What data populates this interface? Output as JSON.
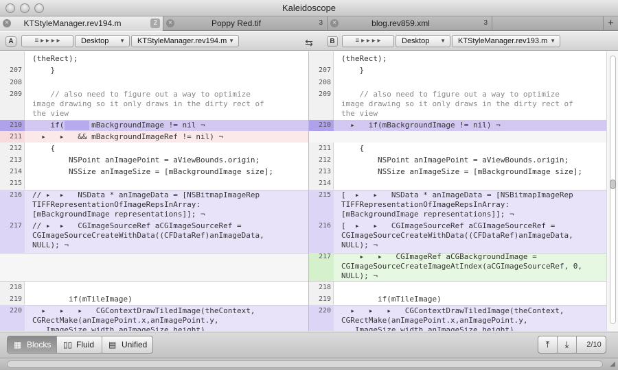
{
  "app": {
    "title": "Kaleidoscope"
  },
  "tabs": [
    {
      "label": "KTStyleManager.rev194.m",
      "count": "2"
    },
    {
      "label": "Poppy Red.tif",
      "count": "3"
    },
    {
      "label": "blog.rev859.xml",
      "count": "3"
    }
  ],
  "tab_add_label": "+",
  "pathbar": {
    "left": {
      "side": "A",
      "folder": "Desktop",
      "file": "KTStyleManager.rev194.m"
    },
    "right": {
      "side": "B",
      "folder": "Desktop",
      "file": "KTStyleManager.rev193.m"
    },
    "swap_icon": "⇆"
  },
  "left_pane": {
    "lines": [
      {
        "n": "",
        "text": "(theRect);"
      },
      {
        "n": "207",
        "text": "    }"
      },
      {
        "n": "208",
        "text": ""
      },
      {
        "n": "209",
        "text": "    // also need to figure out a way to optimize\nimage drawing so it only draws in the dirty rect of\nthe view"
      },
      {
        "n": "210",
        "text": "    if(      mBackgroundImage != nil ¬"
      },
      {
        "n": "211",
        "text": "  ▸   ▸   && mBackgroundImageRef != nil) ¬"
      },
      {
        "n": "212",
        "text": "    {"
      },
      {
        "n": "213",
        "text": "        NSPoint anImagePoint = aViewBounds.origin;"
      },
      {
        "n": "214",
        "text": "        NSSize anImageSize = [mBackgroundImage size];"
      },
      {
        "n": "215",
        "text": ""
      },
      {
        "n": "216",
        "text": "// ▸  ▸   NSData * anImageData = [NSBitmapImageRep\nTIFFRepresentationOfImageRepsInArray:\n[mBackgroundImage representations]]; ¬"
      },
      {
        "n": "217",
        "text": "// ▸  ▸   CGImageSourceRef aCGImageSourceRef =\nCGImageSourceCreateWithData((CFDataRef)anImageData,\nNULL); ¬"
      },
      {
        "n": "218",
        "text": ""
      },
      {
        "n": "219",
        "text": "        if(mTileImage)"
      },
      {
        "n": "220",
        "text": "  ▸   ▸   ▸   CGContextDrawTiledImage(theContext,\nCGRectMake(anImagePoint.x,anImagePoint.y,\n   ImageSize.width,anImageSize.height),"
      }
    ]
  },
  "right_pane": {
    "lines": [
      {
        "n": "",
        "text": "(theRect);"
      },
      {
        "n": "207",
        "text": "    }"
      },
      {
        "n": "208",
        "text": ""
      },
      {
        "n": "209",
        "text": "    // also need to figure out a way to optimize\nimage drawing so it only draws in the dirty rect of\nthe view"
      },
      {
        "n": "210",
        "text": "  ▸   if(mBackgroundImage != nil) ¬"
      },
      {
        "n": "211",
        "text": "    {"
      },
      {
        "n": "212",
        "text": "        NSPoint anImagePoint = aViewBounds.origin;"
      },
      {
        "n": "213",
        "text": "        NSSize anImageSize = [mBackgroundImage size];"
      },
      {
        "n": "214",
        "text": ""
      },
      {
        "n": "215",
        "text": "[  ▸   ▸   NSData * anImageData = [NSBitmapImageRep\nTIFFRepresentationOfImageRepsInArray:\n[mBackgroundImage representations]]; ¬"
      },
      {
        "n": "216",
        "text": "[  ▸   ▸   CGImageSourceRef aCGImageSourceRef =\nCGImageSourceCreateWithData((CFDataRef)anImageData,\nNULL); ¬"
      },
      {
        "n": "217",
        "text": "    ▸   ▸   CGImageRef aCGBackgroundImage =\nCGImageSourceCreateImageAtIndex(aCGImageSourceRef, 0,\nNULL); ¬"
      },
      {
        "n": "218",
        "text": ""
      },
      {
        "n": "219",
        "text": "        if(mTileImage)"
      },
      {
        "n": "220",
        "text": "  ▸   ▸   ▸   CGContextDrawTiledImage(theContext,\nCGRectMake(anImagePoint.x,anImagePoint.y,\n   ImageSize.width,anImageSize.height),"
      }
    ]
  },
  "toolbar": {
    "modes": [
      {
        "label": "Blocks",
        "icon": "blocks-icon",
        "glyph": "▦"
      },
      {
        "label": "Fluid",
        "icon": "fluid-icon",
        "glyph": "▯▯"
      },
      {
        "label": "Unified",
        "icon": "unified-icon",
        "glyph": "▤"
      }
    ],
    "prev_glyph": "⤒",
    "next_glyph": "⤓",
    "change_count": "2/10"
  },
  "colors": {
    "changed": "#e9e3fa",
    "highlight": "#d2c8f2",
    "deleted": "#fbe9e9",
    "added": "#e7f8e2"
  }
}
